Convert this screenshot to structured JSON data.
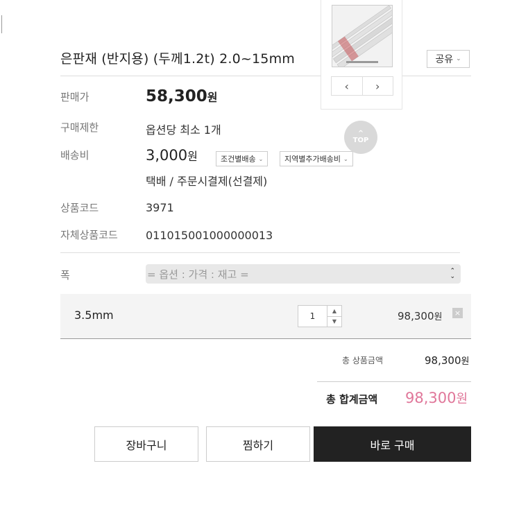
{
  "product": {
    "title": "은판재 (반지용) (두께1.2t) 2.0~15mm",
    "share_label": "공유"
  },
  "info": {
    "price_label": "판매가",
    "price_value": "58,300",
    "currency": "원",
    "limit_label": "구매제한",
    "limit_value": "옵션당 최소 1개",
    "shipping_label": "배송비",
    "shipping_value": "3,000",
    "shipping_tag_1": "조건별배송",
    "shipping_tag_2": "지역별추가배송비",
    "shipping_method": "택배  / 주문시결제(선결제)",
    "code_label": "상품코드",
    "code_value": "3971",
    "own_code_label": "자체상품코드",
    "own_code_value": "011015001000000013"
  },
  "option": {
    "label": "폭",
    "placeholder": "= 옵션 : 가격 : 재고 ="
  },
  "selected_option": {
    "name": "3.5mm",
    "quantity": "1",
    "price": "98,300"
  },
  "summary": {
    "subtotal_label": "총 상품금액",
    "subtotal_value": "98,300",
    "total_label": "총 합계금액",
    "total_value": "98,300"
  },
  "buttons": {
    "cart": "장바구니",
    "wish": "찜하기",
    "buy": "바로 구매"
  },
  "top_button": "TOP",
  "colors": {
    "accent_total": "#e0779a",
    "buy_button": "#222222"
  }
}
